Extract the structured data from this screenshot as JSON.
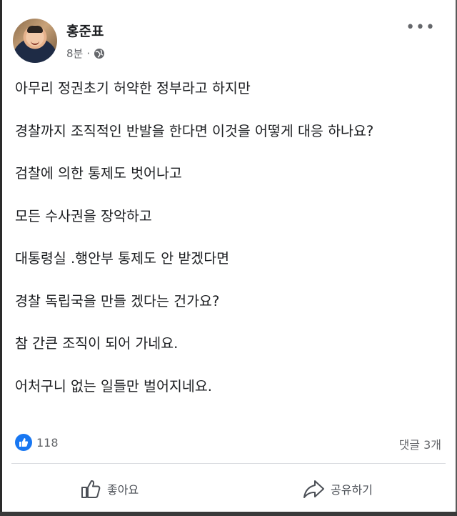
{
  "post": {
    "author": "홍준표",
    "time": "8분",
    "separator": "·",
    "privacy_icon": "globe-icon",
    "more_icon": "more-horizontal-icon",
    "more_label": "•••"
  },
  "content": {
    "lines": [
      "아무리 정권초기 허약한 정부라고 하지만",
      "경찰까지 조직적인 반발을 한다면 이것을 어떻게 대응 하나요?",
      "검찰에 의한 통제도 벗어나고",
      "모든 수사권을 장악하고",
      "대통령실 .행안부 통제도 안 받겠다면",
      "경찰 독립국을 만들 겠다는 건가요?",
      "참 간큰 조직이 되어 가네요.",
      "어처구니 없는 일들만 벌어지네요."
    ]
  },
  "stats": {
    "like_count": "118",
    "comment_count": "댓글 3개",
    "reaction_icon": "like-reaction-icon"
  },
  "actions": {
    "like_label": "좋아요",
    "share_label": "공유하기",
    "like_icon": "thumbs-up-icon",
    "share_icon": "share-arrow-icon"
  },
  "colors": {
    "accent": "#1877f2",
    "text": "#1c1e21",
    "secondary_text": "#65676b"
  }
}
